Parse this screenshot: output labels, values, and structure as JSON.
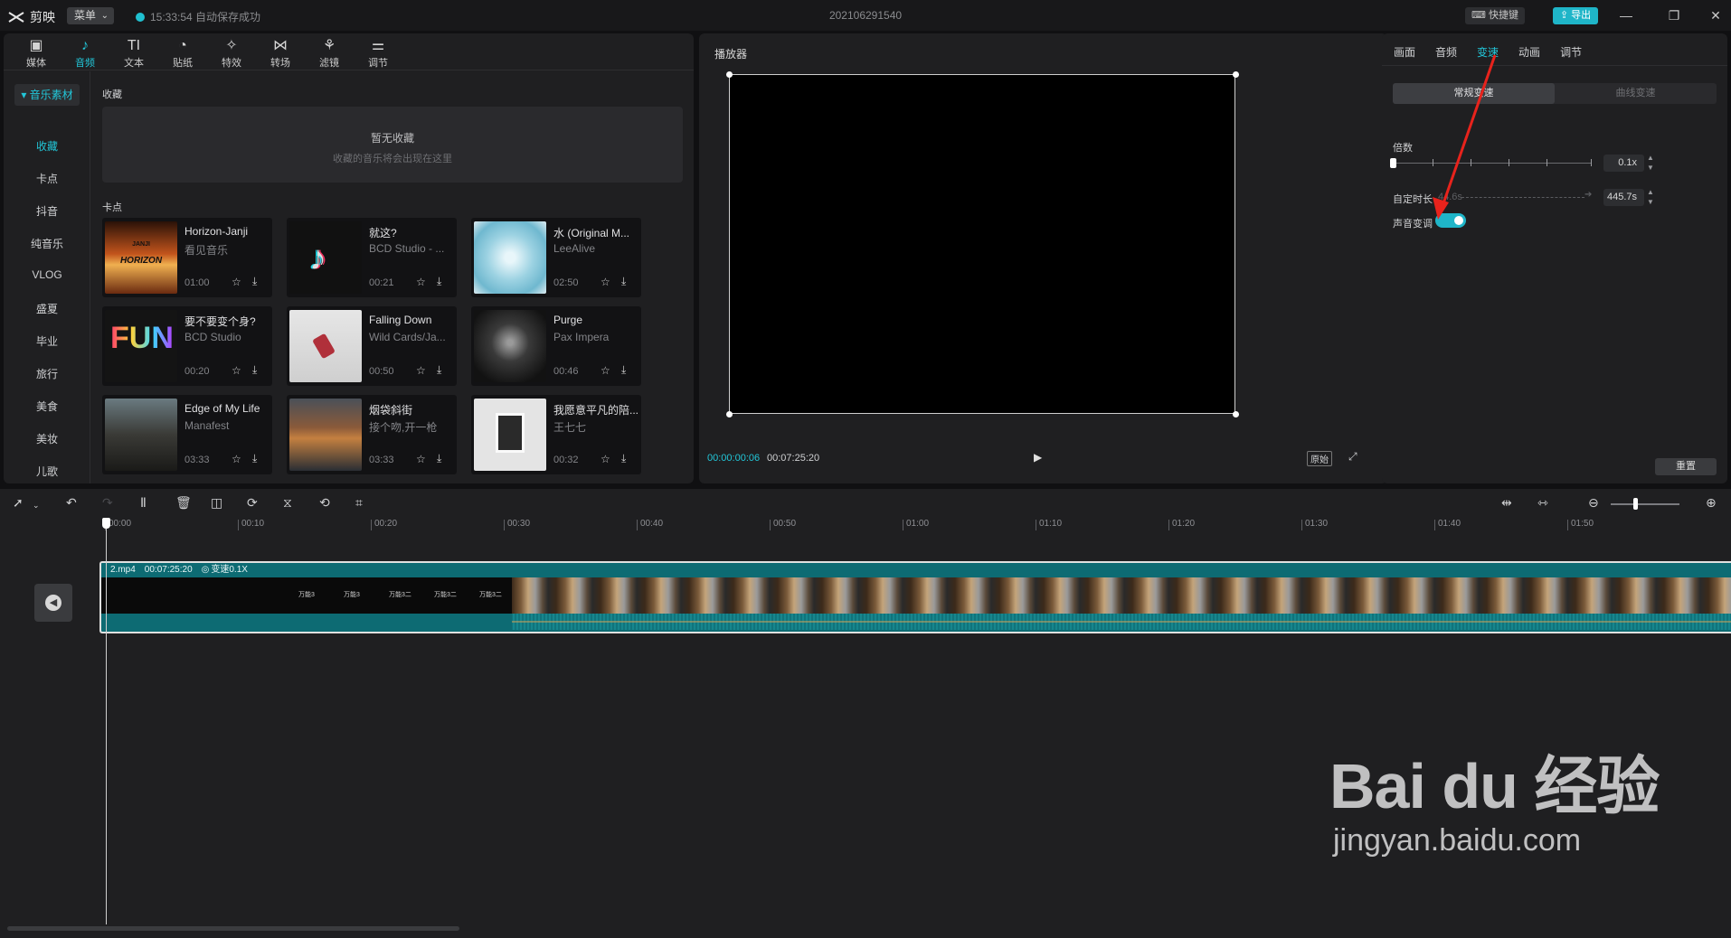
{
  "titlebar": {
    "app_name": "剪映",
    "menu_label": "菜单",
    "save_status": "15:33:54 自动保存成功",
    "project_title": "202106291540",
    "shortcut_label": "快捷键",
    "export_label": "导出"
  },
  "toolbar": {
    "tools": [
      {
        "label": "媒体",
        "icon": "media-icon"
      },
      {
        "label": "音频",
        "icon": "audio-icon"
      },
      {
        "label": "文本",
        "icon": "text-icon"
      },
      {
        "label": "贴纸",
        "icon": "sticker-icon"
      },
      {
        "label": "特效",
        "icon": "effects-icon"
      },
      {
        "label": "转场",
        "icon": "transition-icon"
      },
      {
        "label": "滤镜",
        "icon": "filter-icon"
      },
      {
        "label": "调节",
        "icon": "adjust-icon"
      }
    ],
    "active_index": 1
  },
  "music": {
    "header": "音乐素材",
    "categories": [
      "收藏",
      "卡点",
      "抖音",
      "纯音乐",
      "VLOG",
      "盛夏",
      "毕业",
      "旅行",
      "美食",
      "美妆",
      "儿歌"
    ],
    "favorites_label": "收藏",
    "favorites_empty_title": "暂无收藏",
    "favorites_empty_sub": "收藏的音乐将会出现在这里",
    "section_label": "卡点",
    "tracks": [
      {
        "title": "Horizon-Janji",
        "artist": "看见音乐",
        "duration": "01:00"
      },
      {
        "title": "就这?",
        "artist": "BCD Studio - ...",
        "duration": "00:21"
      },
      {
        "title": "水 (Original M...",
        "artist": "LeeAlive",
        "duration": "02:50"
      },
      {
        "title": "要不要变个身?",
        "artist": "BCD Studio",
        "duration": "00:20"
      },
      {
        "title": "Falling Down",
        "artist": "Wild Cards/Ja...",
        "duration": "00:50"
      },
      {
        "title": "Purge",
        "artist": "Pax Impera",
        "duration": "00:46"
      },
      {
        "title": "Edge of My Life",
        "artist": "Manafest",
        "duration": "03:33"
      },
      {
        "title": "烟袋斜街",
        "artist": "接个吻,开一枪",
        "duration": "03:33"
      },
      {
        "title": "我愿意平凡的陪...",
        "artist": "王七七",
        "duration": "00:32"
      }
    ],
    "thumb_texts": {
      "horizon_top": "JANJI",
      "horizon_main": "HORIZON",
      "fun": "FUN"
    }
  },
  "player": {
    "label": "播放器",
    "current_time": "00:00:00:06",
    "total_time": "00:07:25:20",
    "original_label": "原始"
  },
  "properties": {
    "tabs": [
      "画面",
      "音频",
      "变速",
      "动画",
      "调节"
    ],
    "active_tab": 2,
    "mode_normal": "常规变速",
    "mode_curve": "曲线变速",
    "multiplier_label": "倍数",
    "multiplier_value": "0.1x",
    "custom_duration_label": "自定时长",
    "custom_duration_from": "44.6s",
    "custom_duration_value": "445.7s",
    "pitch_label": "声音变调",
    "pitch_enabled": true,
    "reset_label": "重置"
  },
  "timeline": {
    "ruler_labels": [
      "00:00",
      "00:10",
      "00:20",
      "00:30",
      "00:40",
      "00:50",
      "01:00",
      "01:10",
      "01:20",
      "01:30",
      "01:40",
      "01:50"
    ],
    "clip": {
      "filename": "2.mp4",
      "duration": "00:07:25:20",
      "speed_label": "变速0.1X",
      "frame_texts": [
        "万能3",
        "万能3",
        "万能3二",
        "万能3二",
        "万能3二"
      ]
    }
  },
  "watermark": {
    "logo_text": "Bai du 经验",
    "url": "jingyan.baidu.com"
  },
  "colors": {
    "accent": "#22c6d8",
    "panel_bg": "#1f1f21",
    "app_bg": "#101012",
    "clip_teal": "#0d6b73",
    "annotation_red": "#e8231c"
  }
}
